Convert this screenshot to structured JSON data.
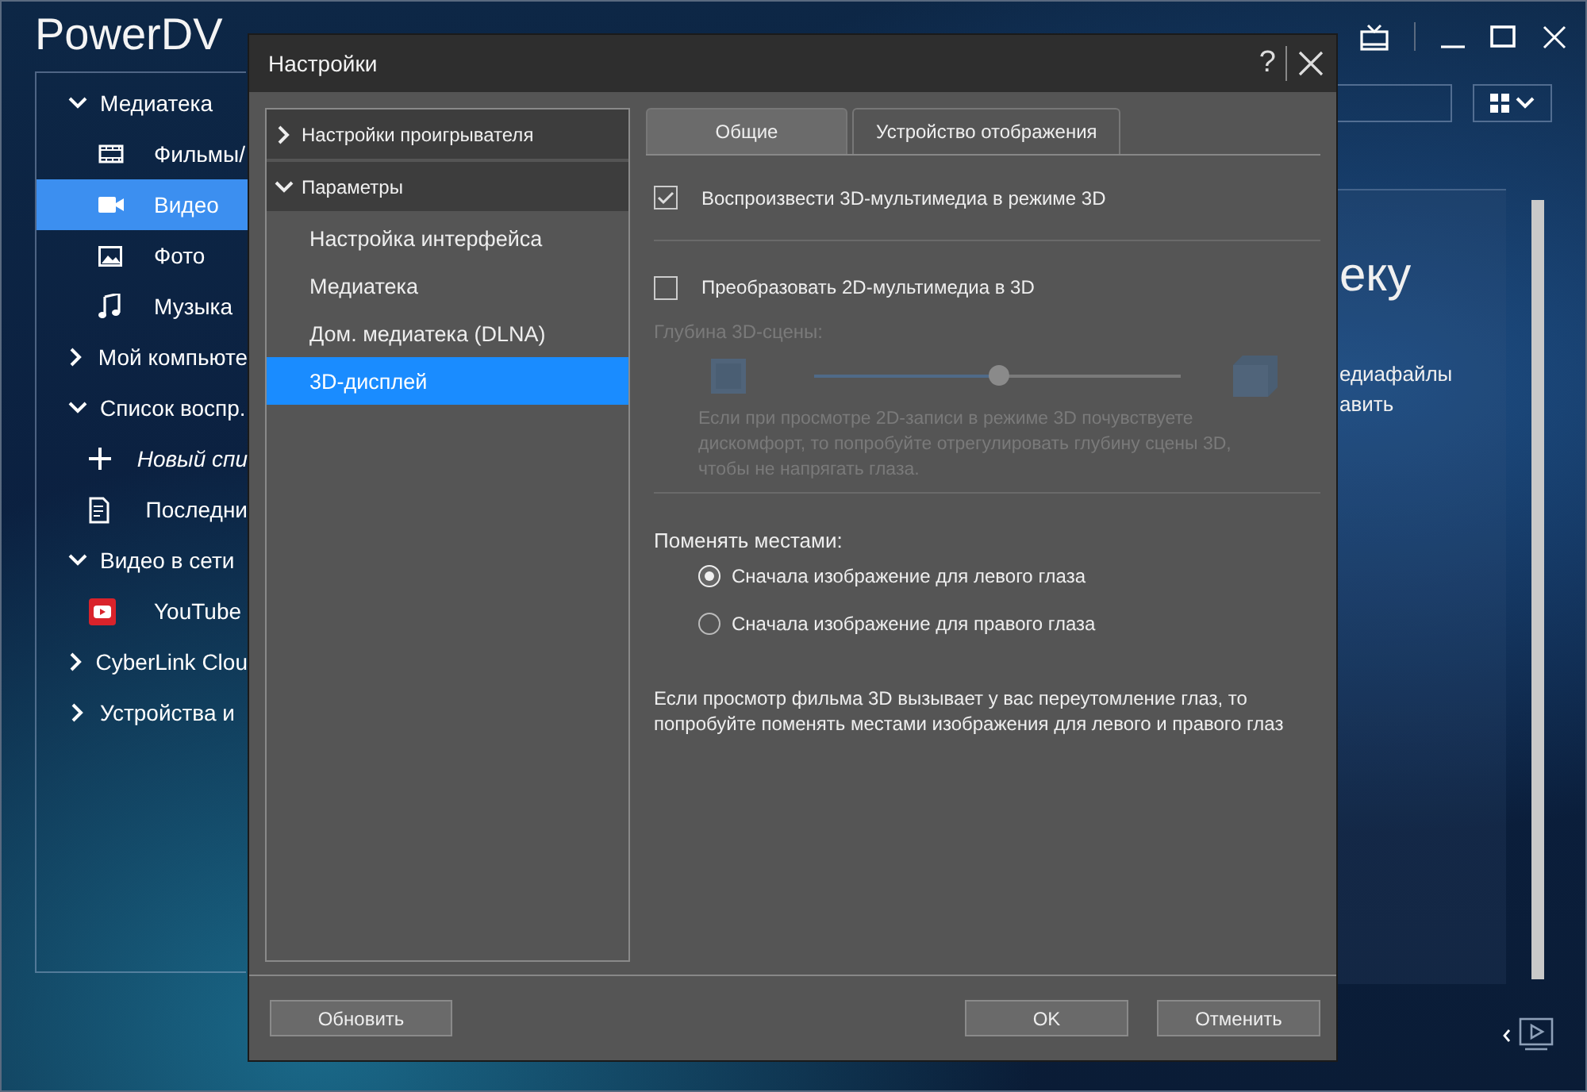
{
  "app": {
    "title": "PowerDV",
    "nav": [
      {
        "label": "Медиатека",
        "expanded": true,
        "children": [
          {
            "label": "Фильмы/",
            "kind": "film",
            "italic": false,
            "selected": false
          },
          {
            "label": "Видео",
            "kind": "camera",
            "italic": false,
            "selected": true
          },
          {
            "label": "Фото",
            "kind": "photo",
            "italic": false,
            "selected": false
          },
          {
            "label": "Музыка",
            "kind": "note",
            "italic": false,
            "selected": false
          }
        ]
      },
      {
        "label": "Мой компьюте",
        "expanded": false
      },
      {
        "label": "Список воспр.",
        "expanded": true,
        "children": [
          {
            "label": "Новый спи",
            "kind": "plus",
            "italic": true,
            "selected": false
          },
          {
            "label": "Последни",
            "kind": "document",
            "italic": false,
            "selected": false
          }
        ]
      },
      {
        "label": "Видео в сети",
        "expanded": true,
        "children": [
          {
            "label": "YouTube",
            "kind": "youtube",
            "italic": false,
            "selected": false
          }
        ]
      },
      {
        "label": "CyberLink Clou",
        "expanded": false
      },
      {
        "label": "Устройства и",
        "expanded": false
      }
    ],
    "card": {
      "heading": "еку",
      "lines": [
        "едиафайлы",
        "авить"
      ]
    }
  },
  "dialog": {
    "title": "Настройки",
    "help": "?",
    "tree": [
      {
        "label": "Настройки проигрывателя",
        "expanded": false
      },
      {
        "label": "Параметры",
        "expanded": true,
        "children": [
          {
            "label": "Настройка интерфейса",
            "selected": false
          },
          {
            "label": "Медиатека",
            "selected": false
          },
          {
            "label": "Дом. медиатека (DLNA)",
            "selected": false
          },
          {
            "label": "3D-дисплей",
            "selected": true
          }
        ]
      }
    ],
    "tabs": [
      {
        "label": "Общие",
        "selected": true
      },
      {
        "label": "Устройство отображения",
        "selected": false
      }
    ],
    "settings": [
      {
        "kind": "checkbox",
        "label": "Воспроизвести 3D-мультимедиа в режиме 3D",
        "checked": true
      },
      {
        "kind": "checkbox",
        "label": "Преобразовать 2D-мультимедиа в 3D",
        "checked": false
      },
      {
        "kind": "slider",
        "label": "Глубина 3D-сцены:",
        "disabled": true,
        "level": 0.5,
        "note": "Если при просмотре 2D-записи в режиме 3D почувствуете дискомфорт, то попробуйте отрегулировать глубину сцены 3D, чтобы не напрягать глаза."
      },
      {
        "kind": "radio-group",
        "label": "Поменять местами:",
        "options": [
          {
            "label": "Сначала изображение для левого глаза",
            "selected": true
          },
          {
            "label": "Сначала изображение для правого глаза",
            "selected": false
          }
        ]
      },
      {
        "kind": "note",
        "text": "Если просмотр фильма 3D вызывает у вас переутомление глаз, то попробуйте поменять местами изображения для левого и правого глаз"
      }
    ],
    "buttons": [
      {
        "kind": "left",
        "label": "Обновить"
      },
      {
        "kind": "right",
        "label": "OK"
      },
      {
        "kind": "right",
        "label": "Отменить"
      }
    ]
  }
}
